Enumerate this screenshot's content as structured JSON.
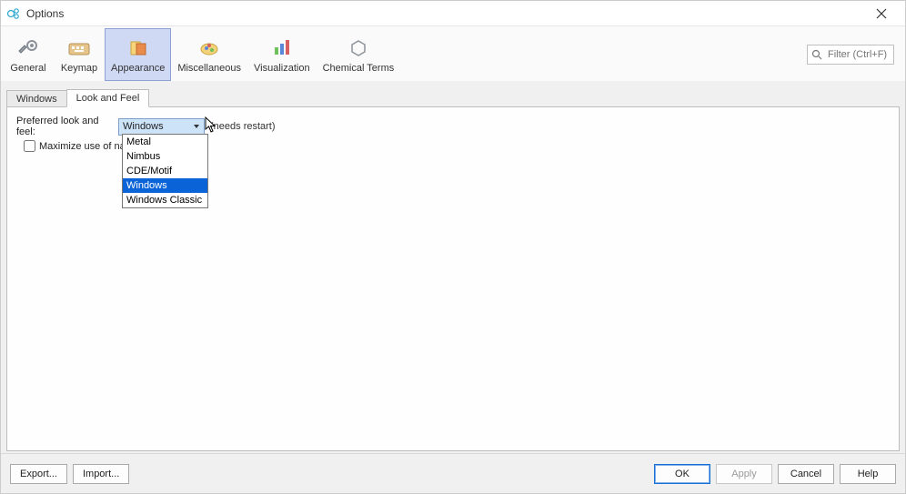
{
  "window": {
    "title": "Options"
  },
  "search": {
    "placeholder": "Filter (Ctrl+F)"
  },
  "toolbar": {
    "items": [
      {
        "id": "general",
        "label": "General"
      },
      {
        "id": "keymap",
        "label": "Keymap"
      },
      {
        "id": "appearance",
        "label": "Appearance"
      },
      {
        "id": "miscellaneous",
        "label": "Miscellaneous"
      },
      {
        "id": "visualization",
        "label": "Visualization"
      },
      {
        "id": "chemical-terms",
        "label": "Chemical Terms"
      }
    ],
    "selected": "appearance"
  },
  "subtabs": {
    "items": [
      {
        "id": "windows",
        "label": "Windows"
      },
      {
        "id": "look-and-feel",
        "label": "Look and Feel"
      }
    ],
    "active": "look-and-feel"
  },
  "form": {
    "laf_label": "Preferred look and feel:",
    "laf_value": "Windows",
    "laf_hint": "(needs restart)",
    "laf_options": [
      "Metal",
      "Nimbus",
      "CDE/Motif",
      "Windows",
      "Windows Classic"
    ],
    "laf_highlight": "Windows",
    "maximize_label": "Maximize use of nat",
    "maximize_checked": false
  },
  "buttons": {
    "export": "Export...",
    "import": "Import...",
    "ok": "OK",
    "apply": "Apply",
    "cancel": "Cancel",
    "help": "Help"
  }
}
